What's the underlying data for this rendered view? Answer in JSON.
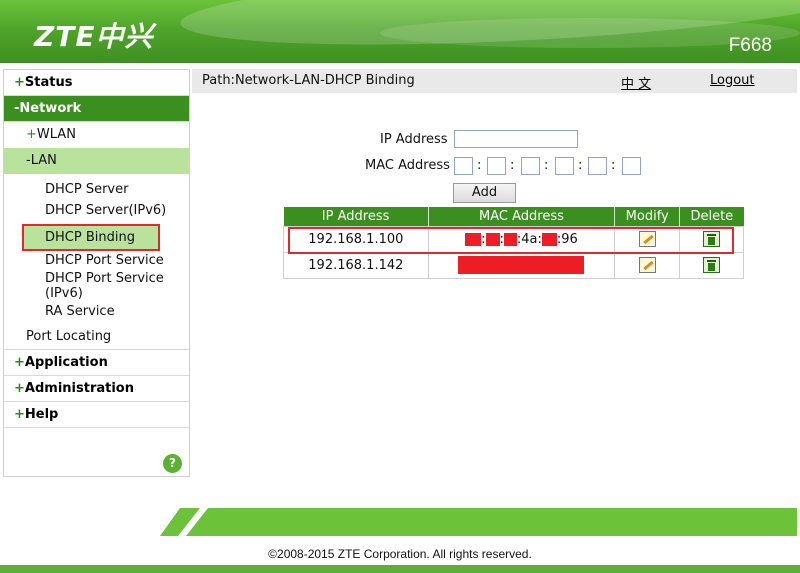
{
  "header": {
    "logo": "ZTE中兴",
    "model": "F668"
  },
  "sidebar": {
    "status": "Status",
    "network": "-Network",
    "wlan": "WLAN",
    "lan": "-LAN",
    "lan_items": [
      "DHCP Server",
      "DHCP Server(IPv6)",
      "DHCP Binding",
      "DHCP Port Service",
      "DHCP Port Service",
      "(IPv6)",
      "RA Service"
    ],
    "port_locating": "Port Locating",
    "application": "Application",
    "administration": "Administration",
    "help": "Help",
    "help_icon": "?"
  },
  "pathbar": {
    "path": "Path:Network-LAN-DHCP Binding",
    "lang": "中 文",
    "logout": "Logout"
  },
  "form": {
    "ip_label": "IP Address",
    "mac_label": "MAC Address",
    "colon": ":",
    "add_button": "Add"
  },
  "table": {
    "headers": [
      "IP Address",
      "MAC Address",
      "Modify",
      "Delete"
    ],
    "rows": [
      {
        "ip": "192.168.1.100",
        "mac_part1": ":4a:",
        "mac_part2": ":96"
      },
      {
        "ip": "192.168.1.142"
      }
    ]
  },
  "footer": {
    "copyright": "©2008-2015 ZTE Corporation. All rights reserved."
  },
  "colors": {
    "green_dark": "#3a8f1f",
    "green_light": "#b9e39c",
    "highlight_red": "#e02a2a",
    "redaction": "#ee1c25"
  }
}
